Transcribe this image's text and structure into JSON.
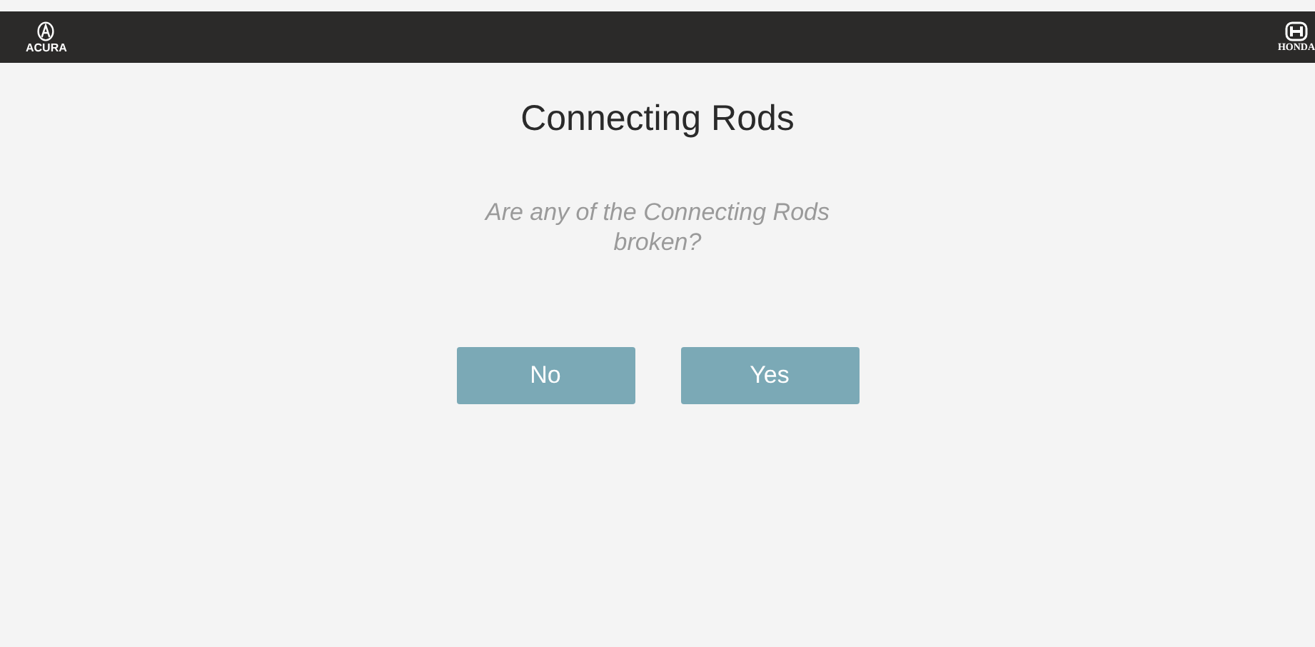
{
  "header": {
    "left_logo": "ACURA",
    "right_logo": "HONDA"
  },
  "title": "Connecting Rods",
  "question": "Are any of the Connecting Rods broken?",
  "buttons": [
    {
      "label": "No"
    },
    {
      "label": "Yes"
    }
  ]
}
